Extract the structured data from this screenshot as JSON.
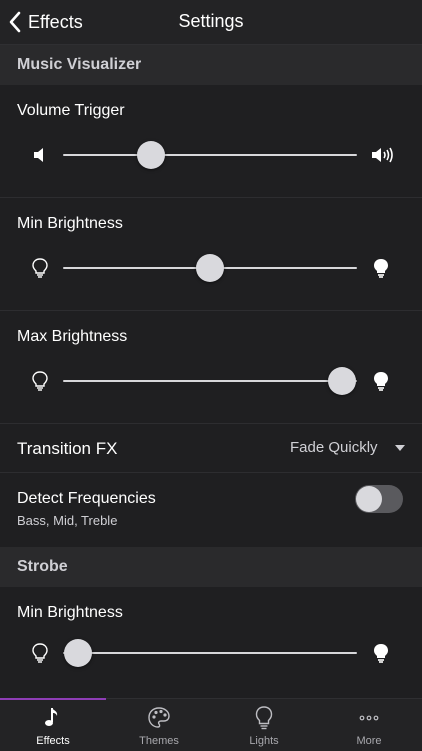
{
  "nav": {
    "back_label": "Effects",
    "title": "Settings"
  },
  "sections": {
    "music_visualizer": "Music Visualizer",
    "strobe": "Strobe"
  },
  "sliders": {
    "volume_trigger": {
      "label": "Volume Trigger",
      "value": 0.3
    },
    "min_brightness": {
      "label": "Min Brightness",
      "value": 0.5
    },
    "max_brightness": {
      "label": "Max Brightness",
      "value": 0.95
    },
    "strobe_min_brightness": {
      "label": "Min Brightness",
      "value": 0.05
    }
  },
  "transition": {
    "label": "Transition FX",
    "value": "Fade Quickly"
  },
  "detect_frequencies": {
    "label": "Detect Frequencies",
    "sub": "Bass, Mid, Treble",
    "on": false
  },
  "tabs": [
    {
      "label": "Effects",
      "icon": "music-note-icon",
      "active": true
    },
    {
      "label": "Themes",
      "icon": "palette-icon",
      "active": false
    },
    {
      "label": "Lights",
      "icon": "bulb-icon",
      "active": false
    },
    {
      "label": "More",
      "icon": "more-icon",
      "active": false
    }
  ],
  "colors": {
    "accent": "#8e3db6",
    "background": "#1c1c1e"
  }
}
